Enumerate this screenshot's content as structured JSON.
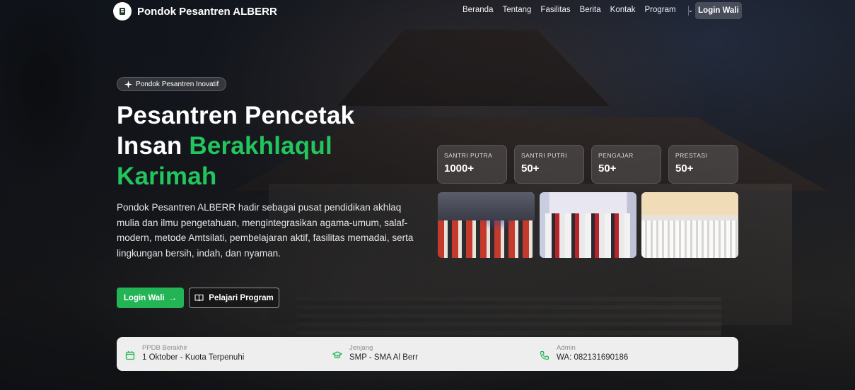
{
  "nav": {
    "brand": "Pondok Pesantren ALBERR",
    "links": [
      "Beranda",
      "Tentang",
      "Fasilitas",
      "Berita",
      "Kontak",
      "Program"
    ],
    "login": "Login Wali"
  },
  "hero": {
    "badge": "Pondok Pesantren Inovatif",
    "title_line1": "Pesantren Pencetak",
    "title_line2_white": "Insan ",
    "title_line2_green": "Berakhlaqul",
    "title_line3_green": "Karimah",
    "description": "Pondok Pesantren ALBERR hadir sebagai pusat pendidikan akhlaq mulia dan ilmu pengetahuan, mengintegrasikan agama-umum, salaf-modern, metode Amtsilati, pembelajaran aktif, fasilitas memadai, serta lingkungan bersih, indah, dan nyaman.",
    "cta_primary": "Login Wali",
    "cta_secondary": "Pelajari Program"
  },
  "stats": [
    {
      "label": "SANTRI PUTRA",
      "value": "1000+"
    },
    {
      "label": "SANTRI PUTRI",
      "value": "50+"
    },
    {
      "label": "PENGAJAR",
      "value": "50+"
    },
    {
      "label": "PRESTASI",
      "value": "50+"
    }
  ],
  "info": [
    {
      "label": "PPDB Berakhir",
      "value": "1 Oktober - Kuota Terpenuhi",
      "icon": "calendar-icon"
    },
    {
      "label": "Jenjang",
      "value": "SMP - SMA Al Berr",
      "icon": "graduation-cap-icon"
    },
    {
      "label": "Admin",
      "value": "WA: 082131690186",
      "icon": "phone-icon"
    }
  ],
  "colors": {
    "accent": "#22c55e",
    "button": "#22b455",
    "infobar": "#eeeeee"
  }
}
